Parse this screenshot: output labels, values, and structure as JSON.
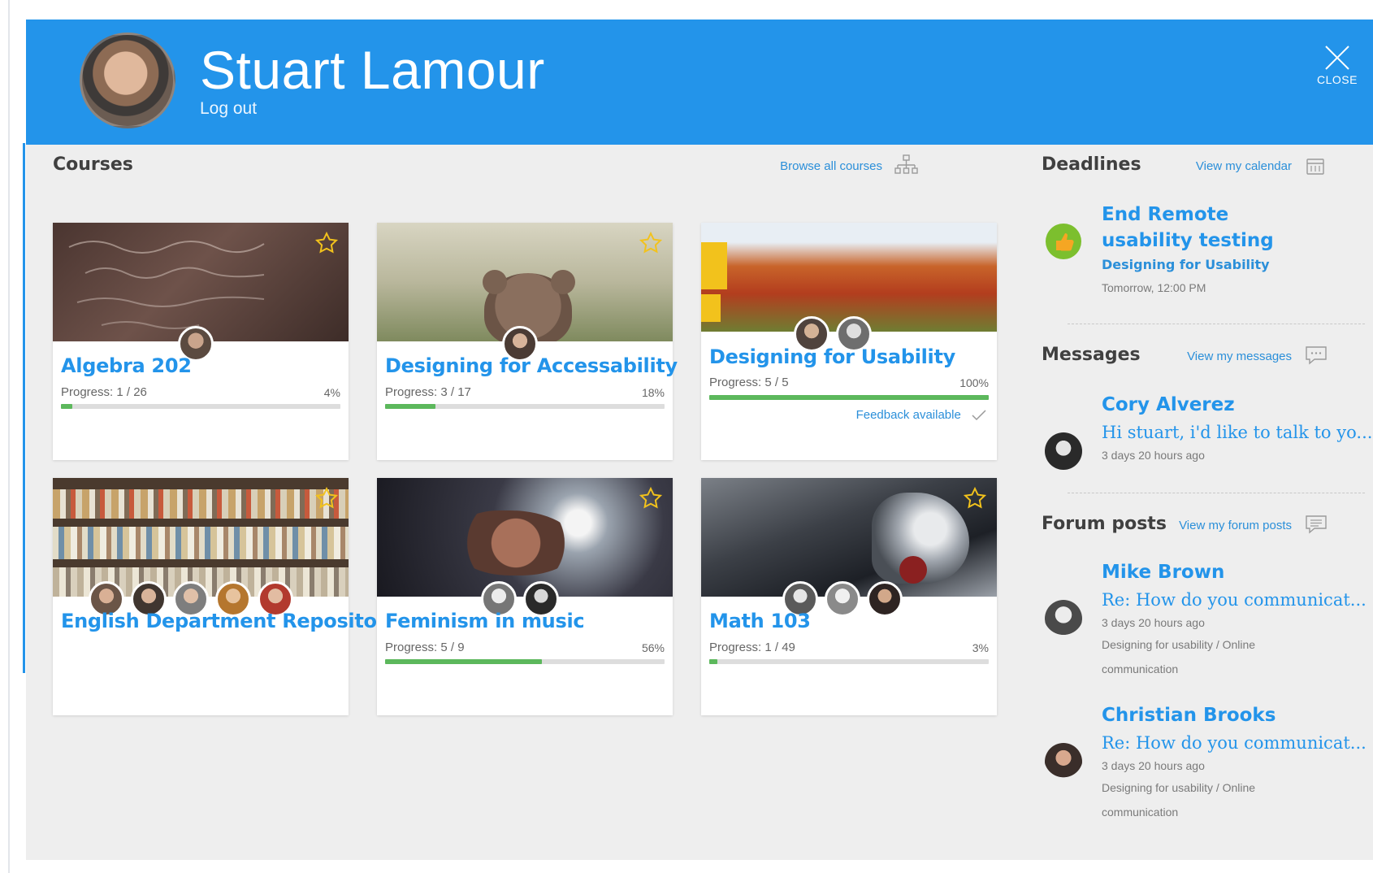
{
  "header": {
    "user_name": "Stuart Lamour",
    "logout": "Log out",
    "close": "CLOSE"
  },
  "courses": {
    "title": "Courses",
    "browse_link": "Browse all courses",
    "items": [
      {
        "title": "Algebra 202",
        "progress_text": "Progress: 1 / 26",
        "percent_text": "4%",
        "progress": 0.04,
        "starred": true
      },
      {
        "title": "Designing for Accessability",
        "progress_text": "Progress: 3 / 17",
        "percent_text": "18%",
        "progress": 0.18,
        "starred": true
      },
      {
        "title": "Designing for Usability",
        "progress_text": "Progress: 5 / 5",
        "percent_text": "100%",
        "progress": 1.0,
        "feedback": "Feedback available",
        "starred": false
      },
      {
        "title": "English Department Repository",
        "starred": true
      },
      {
        "title": "Feminism in music",
        "progress_text": "Progress: 5 / 9",
        "percent_text": "56%",
        "progress": 0.56,
        "starred": true
      },
      {
        "title": "Math 103",
        "progress_text": "Progress: 1 / 49",
        "percent_text": "3%",
        "progress": 0.03,
        "starred": true
      }
    ]
  },
  "deadlines": {
    "title": "Deadlines",
    "link": "View my calendar",
    "item": {
      "title": "End Remote usability testing",
      "course": "Designing for Usability",
      "time": "Tomorrow, 12:00 PM"
    }
  },
  "messages": {
    "title": "Messages",
    "link": "View my messages",
    "item": {
      "name": "Cory Alverez",
      "preview": "Hi stuart, i'd like to talk to yo...",
      "time": "3 days 20 hours ago"
    }
  },
  "forum": {
    "title": "Forum posts",
    "link": "View my forum posts",
    "items": [
      {
        "name": "Mike Brown",
        "subject": "Re: How do you communicat...",
        "time": "3 days 20 hours ago",
        "context": "Designing for usability / Online communication"
      },
      {
        "name": "Christian Brooks",
        "subject": "Re: How do you communicat...",
        "time": "3 days 20 hours ago",
        "context": "Designing for usability / Online communication"
      }
    ]
  },
  "colors": {
    "accent": "#2394ea",
    "progress": "#5cb85c",
    "star": "#f2c21c",
    "background": "#eeeeee"
  }
}
